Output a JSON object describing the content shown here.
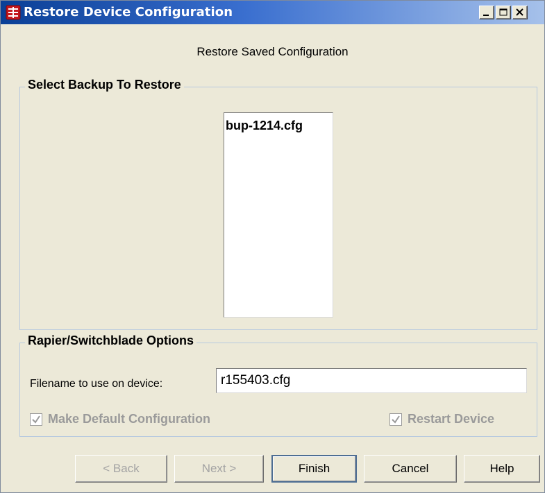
{
  "window": {
    "title": "Restore Device Configuration",
    "icon": "app-icon",
    "controls": [
      "minimize-icon",
      "maximize-icon",
      "close-icon"
    ]
  },
  "subtitle": "Restore Saved Configuration",
  "backup_group": {
    "legend": "Select Backup To Restore",
    "items": [
      "bup-1214.cfg"
    ]
  },
  "options_group": {
    "legend": "Rapier/Switchblade Options",
    "filename_label": "Filename to use on device:",
    "filename_value": "r155403.cfg",
    "make_default": {
      "label": "Make Default Configuration",
      "checked": true,
      "enabled": false
    },
    "restart_device": {
      "label": "Restart Device",
      "checked": true,
      "enabled": false
    }
  },
  "buttons": {
    "back": "< Back",
    "next": "Next >",
    "finish": "Finish",
    "cancel": "Cancel",
    "help": "Help"
  }
}
